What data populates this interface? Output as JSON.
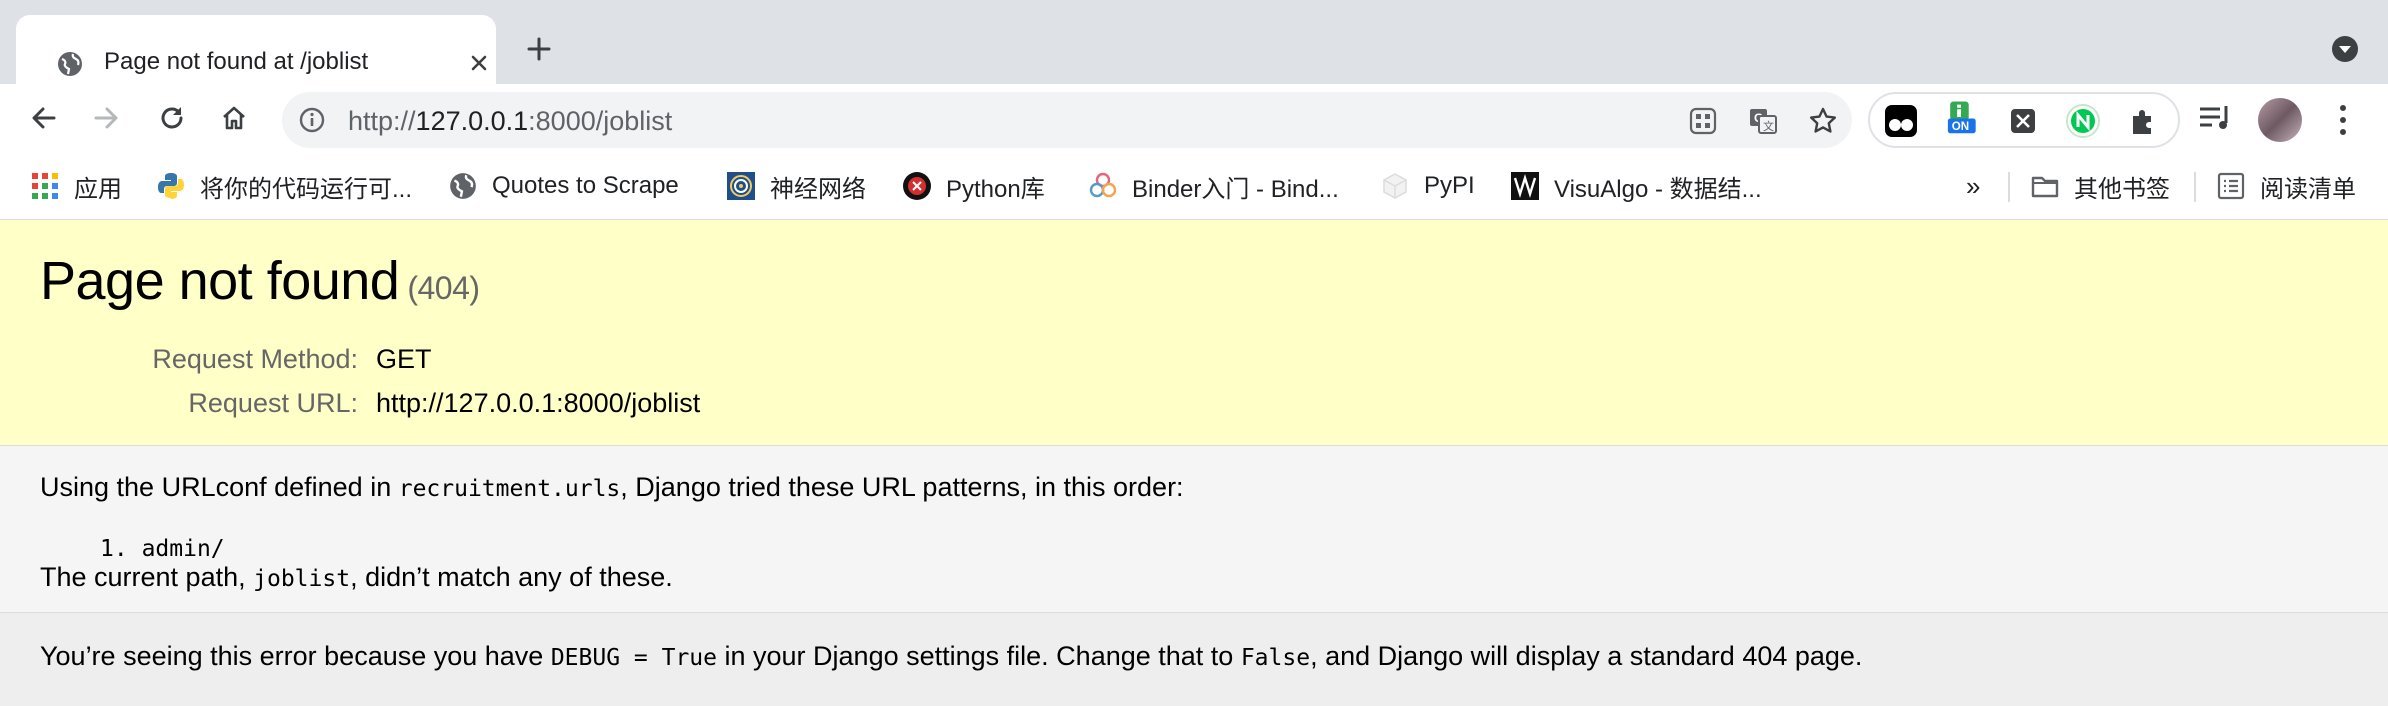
{
  "browser": {
    "tab": {
      "title": "Page not found at /joblist"
    },
    "address": {
      "scheme": "http://",
      "host": "127.0.0.1",
      "rest": ":8000/joblist"
    },
    "extensions": [
      "tampermonkey-icon",
      "jsonview-on-icon",
      "x-extension-icon",
      "nuxt-devtools-icon",
      "puzzle-icon"
    ],
    "extension_badge": "ON",
    "bookmarks": [
      {
        "label": "应用",
        "icon": "apps-grid-icon"
      },
      {
        "label": "将你的代码运行可...",
        "icon": "python-icon"
      },
      {
        "label": "Quotes to Scrape",
        "icon": "globe-icon"
      },
      {
        "label": "神经网络",
        "icon": "spiral-icon"
      },
      {
        "label": "Python库",
        "icon": "red-x-icon"
      },
      {
        "label": "Binder入门 - Bind...",
        "icon": "binder-icon"
      },
      {
        "label": "PyPI",
        "icon": "pypi-cube-icon"
      },
      {
        "label": "VisuAlgo - 数据结...",
        "icon": "visualgo-icon"
      }
    ],
    "bookmarks_overflow": "»",
    "other_bookmarks": "其他书签",
    "reading_list": "阅读清单"
  },
  "page": {
    "title": "Page not found",
    "status_code": "(404)",
    "request_method_label": "Request Method:",
    "request_method": "GET",
    "request_url_label": "Request URL:",
    "request_url": "http://127.0.0.1:8000/joblist",
    "urlconf_prefix": "Using the URLconf defined in ",
    "urlconf_module": "recruitment.urls",
    "urlconf_suffix": ", Django tried these URL patterns, in this order:",
    "patterns": [
      {
        "number": "1.",
        "pattern": "admin/"
      }
    ],
    "current_path_prefix": "The current path, ",
    "current_path": "joblist",
    "current_path_suffix": ", didn’t match any of these.",
    "explanation": {
      "part1": "You’re seeing this error because you have ",
      "code1": "DEBUG = True",
      "part2": " in your Django settings file. Change that to ",
      "code2": "False",
      "part3": ", and Django will display a standard 404 page."
    }
  },
  "colors": {
    "summary_bg": "#ffffc8",
    "info_bg": "#f5f5f5",
    "explanation_bg": "#eeeeee",
    "tabstrip_bg": "#dee1e6"
  }
}
